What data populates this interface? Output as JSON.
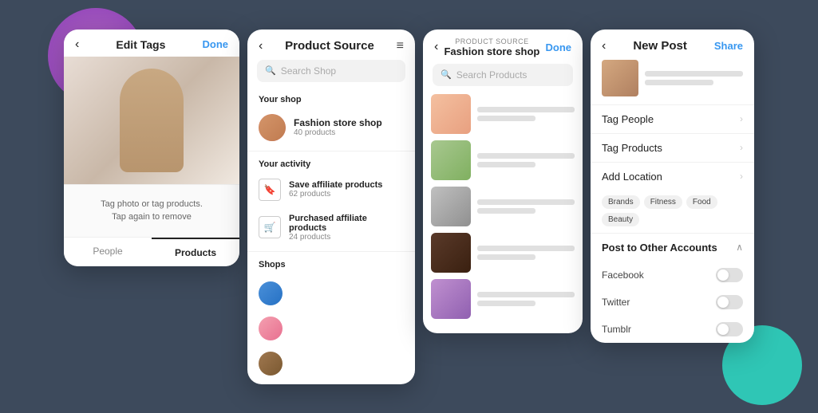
{
  "background": {
    "purple_circle": "decorative",
    "teal_circle": "decorative"
  },
  "card1": {
    "header": {
      "back_label": "‹",
      "title": "Edit Tags",
      "done_label": "Done"
    },
    "hint_line1": "Tag photo or tag products.",
    "hint_line2": "Tap again to remove",
    "tabs": [
      {
        "label": "People",
        "active": false
      },
      {
        "label": "Products",
        "active": true
      }
    ]
  },
  "card2": {
    "header": {
      "back_label": "‹",
      "title": "Product Source",
      "menu_label": "≡"
    },
    "search": {
      "placeholder": "Search Shop"
    },
    "your_shop": {
      "label": "Your shop",
      "name": "Fashion store shop",
      "products": "40 products"
    },
    "your_activity": {
      "label": "Your activity",
      "items": [
        {
          "icon": "🔖",
          "name": "Save affiliate products",
          "sub": "62 products"
        },
        {
          "icon": "🛒",
          "name": "Purchased affiliate products",
          "sub": "24 products"
        }
      ]
    },
    "shops": {
      "label": "Shops",
      "items": [
        {
          "color": "blue"
        },
        {
          "color": "pink"
        },
        {
          "color": "brown"
        }
      ]
    }
  },
  "card3": {
    "source_label": "PRODUCT SOURCE",
    "title": "Fashion store shop",
    "done_label": "Done",
    "back_label": "‹",
    "search_placeholder": "Search Products",
    "products": [
      {
        "thumb": "perfume"
      },
      {
        "thumb": "green"
      },
      {
        "thumb": "fashion"
      },
      {
        "thumb": "shirt"
      },
      {
        "thumb": "purple"
      }
    ]
  },
  "card4": {
    "header": {
      "back_label": "‹",
      "title": "New Post",
      "share_label": "Share"
    },
    "menu_rows": [
      {
        "label": "Tag People",
        "has_chevron": true
      },
      {
        "label": "Tag Products",
        "has_chevron": true
      },
      {
        "label": "Add Location",
        "has_chevron": true
      }
    ],
    "tags": [
      {
        "label": "Brands"
      },
      {
        "label": "Fitness"
      },
      {
        "label": "Food"
      },
      {
        "label": "Beauty"
      }
    ],
    "other_accounts": {
      "label": "Post to Other Accounts",
      "items": [
        {
          "label": "Facebook"
        },
        {
          "label": "Twitter"
        },
        {
          "label": "Tumblr"
        }
      ]
    }
  }
}
